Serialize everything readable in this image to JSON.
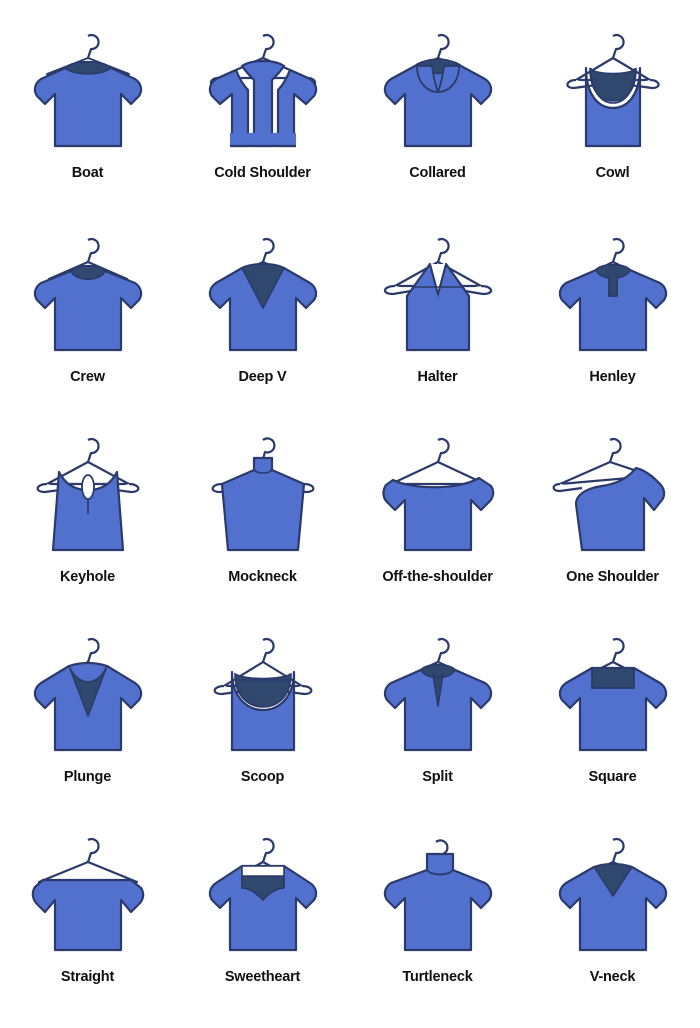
{
  "page": {
    "title": "Neckline Types Chart",
    "background_color": "#ffffff",
    "columns": 4,
    "rows": 5,
    "total_items": 20
  },
  "palette": {
    "garment_fill": "#5271cf",
    "garment_stroke": "#2b3a6b",
    "shadow_fill": "#31486e",
    "hanger_stroke": "#2b3a6b",
    "hanger_fill": "#ffffff",
    "label_color": "#111111"
  },
  "items": [
    {
      "label": "Boat",
      "icon": "boat-neckline-icon"
    },
    {
      "label": "Cold Shoulder",
      "icon": "cold-shoulder-neckline-icon"
    },
    {
      "label": "Collared",
      "icon": "collared-neckline-icon"
    },
    {
      "label": "Cowl",
      "icon": "cowl-neckline-icon"
    },
    {
      "label": "Crew",
      "icon": "crew-neckline-icon"
    },
    {
      "label": "Deep V",
      "icon": "deep-v-neckline-icon"
    },
    {
      "label": "Halter",
      "icon": "halter-neckline-icon"
    },
    {
      "label": "Henley",
      "icon": "henley-neckline-icon"
    },
    {
      "label": "Keyhole",
      "icon": "keyhole-neckline-icon"
    },
    {
      "label": "Mockneck",
      "icon": "mockneck-neckline-icon"
    },
    {
      "label": "Off-the-shoulder",
      "icon": "off-the-shoulder-neckline-icon"
    },
    {
      "label": "One Shoulder",
      "icon": "one-shoulder-neckline-icon"
    },
    {
      "label": "Plunge",
      "icon": "plunge-neckline-icon"
    },
    {
      "label": "Scoop",
      "icon": "scoop-neckline-icon"
    },
    {
      "label": "Split",
      "icon": "split-neckline-icon"
    },
    {
      "label": "Square",
      "icon": "square-neckline-icon"
    },
    {
      "label": "Straight",
      "icon": "straight-neckline-icon"
    },
    {
      "label": "Sweetheart",
      "icon": "sweetheart-neckline-icon"
    },
    {
      "label": "Turtleneck",
      "icon": "turtleneck-neckline-icon"
    },
    {
      "label": "V-neck",
      "icon": "v-neck-neckline-icon"
    }
  ]
}
